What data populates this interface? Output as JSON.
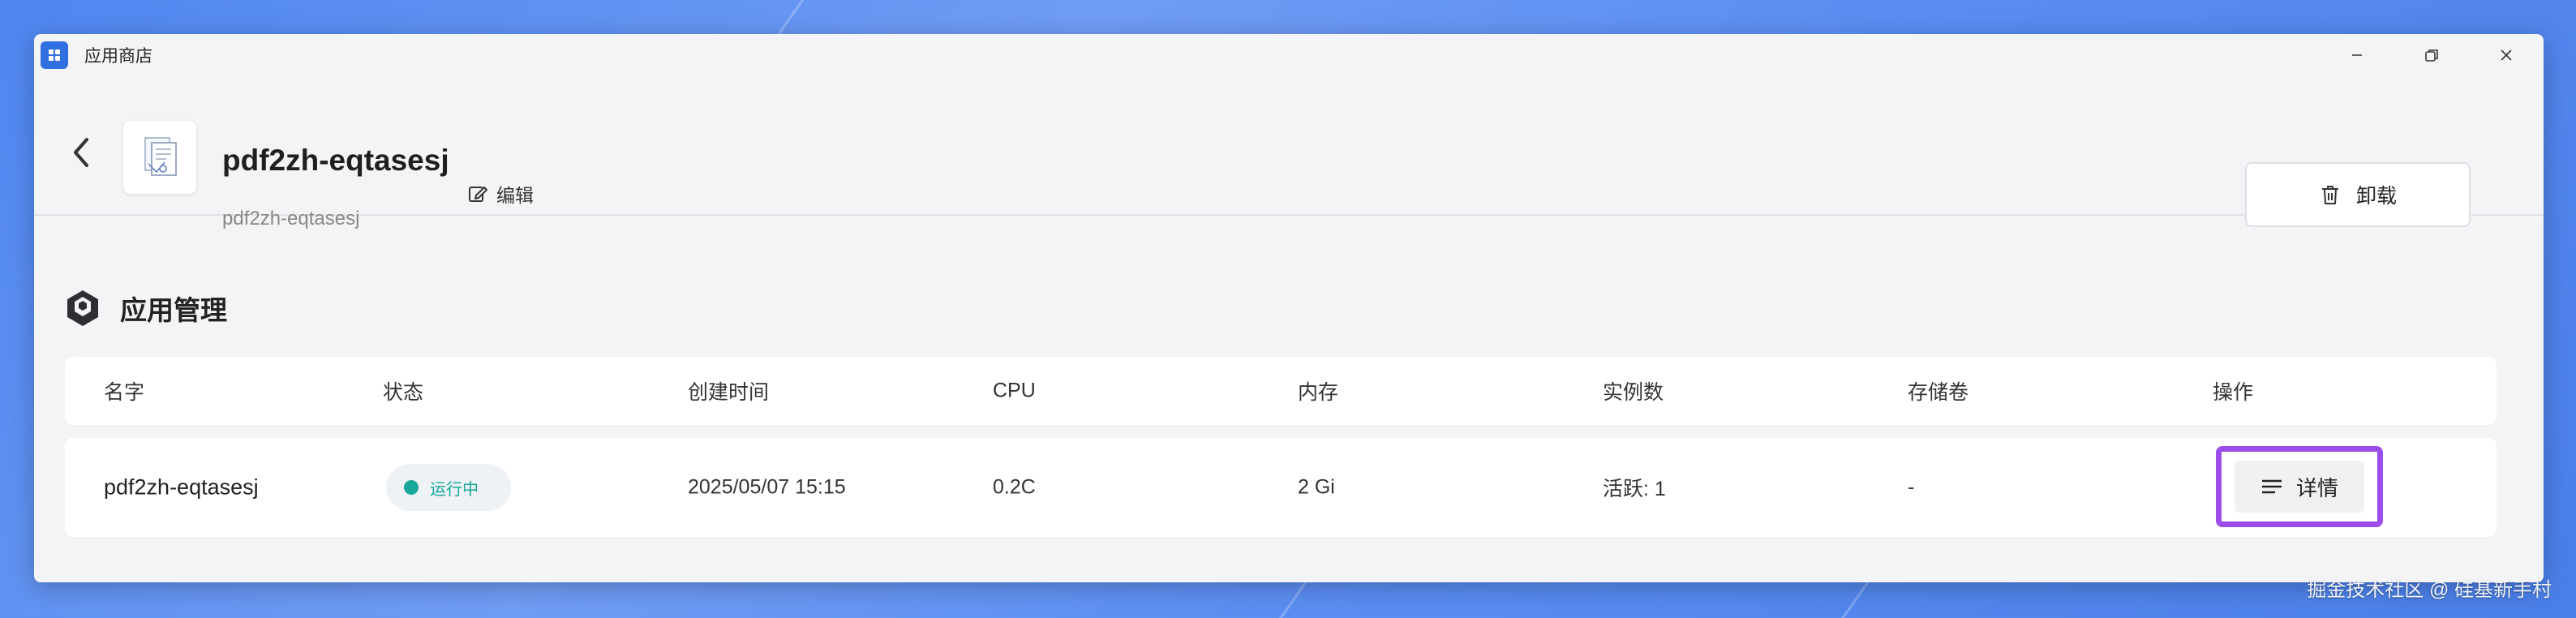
{
  "window": {
    "title": "应用商店",
    "controls": [
      "minimize-icon",
      "restore-icon",
      "close-icon"
    ]
  },
  "header": {
    "app_name": "pdf2zh-eqtasesj",
    "app_subtitle": "pdf2zh-eqtasesj",
    "edit_label": "编辑",
    "uninstall_label": "卸载"
  },
  "section": {
    "title": "应用管理"
  },
  "table": {
    "columns": [
      "名字",
      "状态",
      "创建时间",
      "CPU",
      "内存",
      "实例数",
      "存储卷",
      "操作"
    ],
    "rows": [
      {
        "name": "pdf2zh-eqtasesj",
        "status": "运行中",
        "created": "2025/05/07 15:15",
        "cpu": "0.2C",
        "memory": "2 Gi",
        "instances": "活跃: 1",
        "volumes": "-",
        "action": "详情"
      }
    ]
  },
  "colors": {
    "status_running": "#17a89a",
    "focus_highlight": "#9b4dea",
    "desktop": "#5a8df2"
  },
  "watermark": "掘金技术社区 @ 硅基新手村"
}
